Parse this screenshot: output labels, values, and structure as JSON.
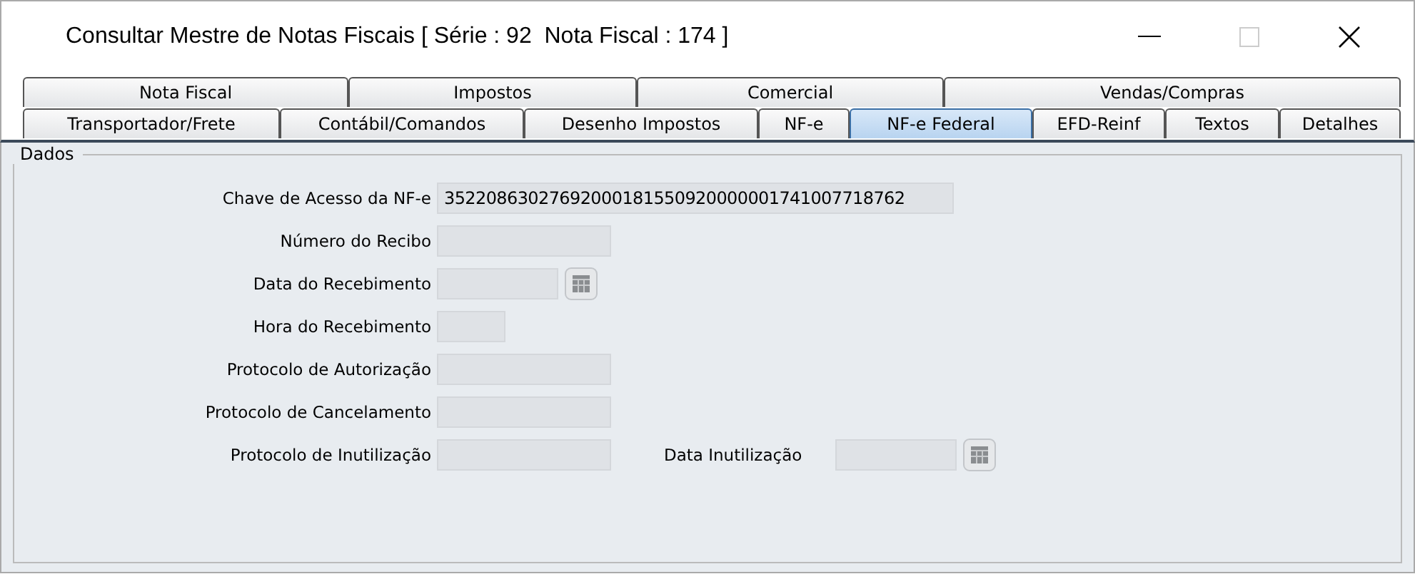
{
  "window": {
    "title": "Consultar Mestre de Notas Fiscais [ Série : 92  Nota Fiscal : 174 ]"
  },
  "tab_rows": [
    [
      {
        "label": "Nota Fiscal",
        "selected": false
      },
      {
        "label": "Impostos",
        "selected": false
      },
      {
        "label": "Comercial",
        "selected": false
      },
      {
        "label": "Vendas/Compras",
        "selected": false
      }
    ],
    [
      {
        "label": "Transportador/Frete",
        "selected": false
      },
      {
        "label": "Contábil/Comandos",
        "selected": false
      },
      {
        "label": "Desenho Impostos",
        "selected": false
      },
      {
        "label": "NF-e",
        "selected": false
      },
      {
        "label": "NF-e Federal",
        "selected": true
      },
      {
        "label": "EFD-Reinf",
        "selected": false
      },
      {
        "label": "Textos",
        "selected": false
      },
      {
        "label": "Detalhes",
        "selected": false
      }
    ]
  ],
  "group": {
    "title": "Dados"
  },
  "fields": [
    {
      "label": "Chave de Acesso da NF-e",
      "kind": "wide",
      "value": "35220863027692000181550920000001741007718762"
    },
    {
      "label": "Número do Recibo",
      "kind": "medium"
    },
    {
      "label": "Data do Recebimento",
      "kind": "date"
    },
    {
      "label": "Hora do Recebimento",
      "kind": "time"
    },
    {
      "label": "Protocolo de Autorização",
      "kind": "medium"
    },
    {
      "label": "Protocolo de Cancelamento",
      "kind": "medium"
    },
    {
      "label": "Protocolo de Inutilização",
      "kind": "medium",
      "side": {
        "label": "Data Inutilização",
        "kind": "date"
      }
    }
  ]
}
